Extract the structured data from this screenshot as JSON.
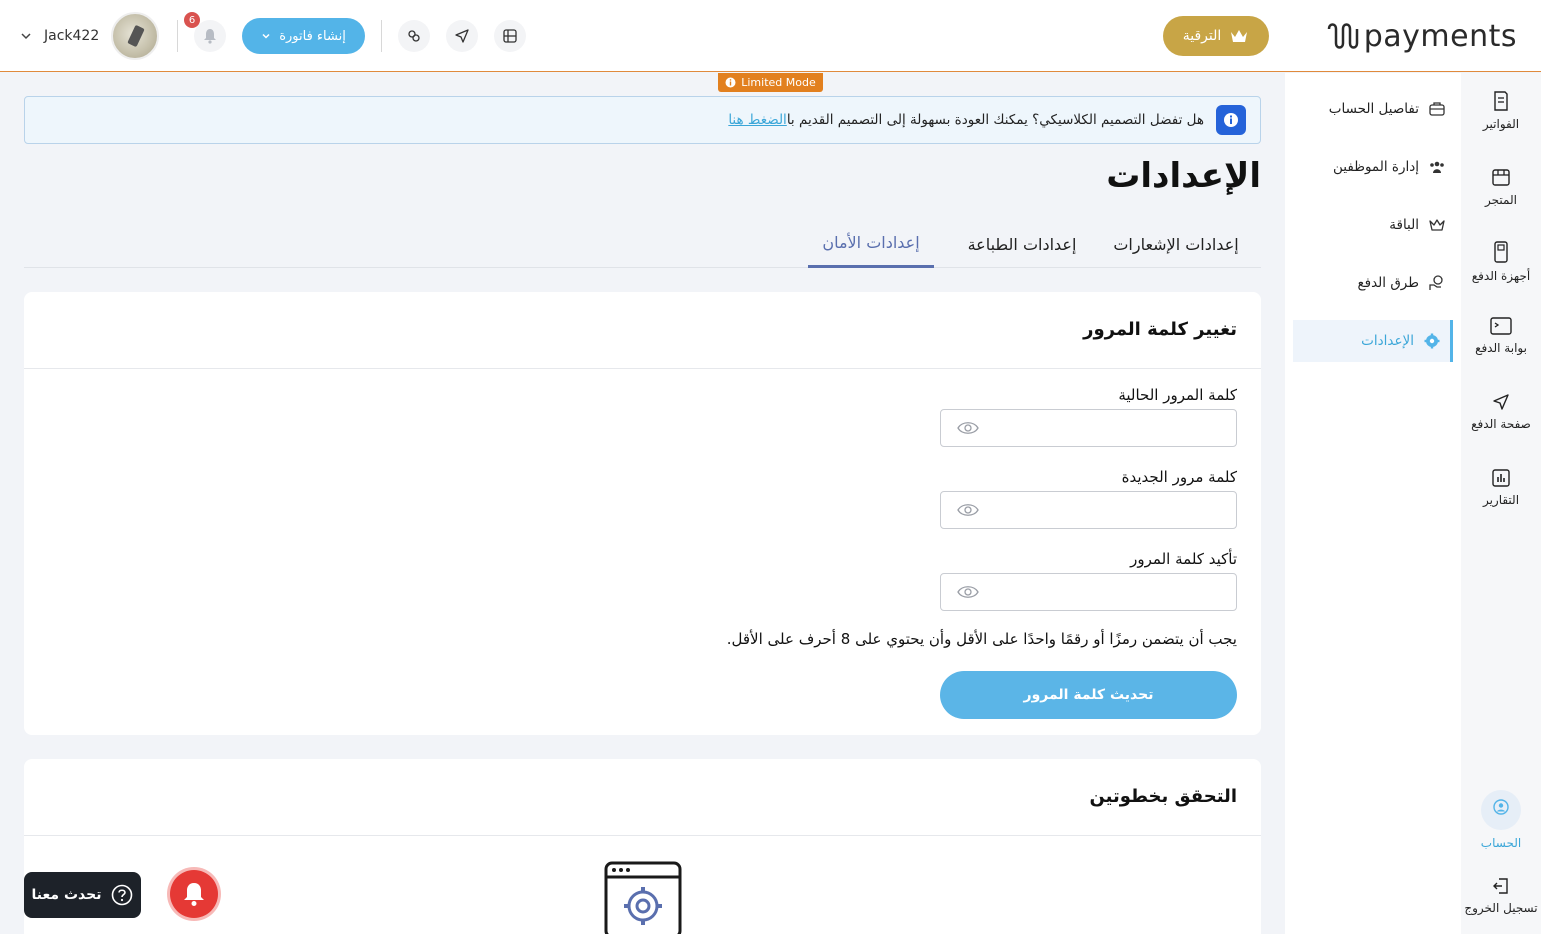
{
  "header": {
    "brand": "payments",
    "upgrade_label": "الترقية",
    "username": "Jack422",
    "notifications_count": "6",
    "create_invoice_label": "إنشاء فاتورة"
  },
  "rail": {
    "items": [
      {
        "label": "الفواتير",
        "icon": "invoice-icon"
      },
      {
        "label": "المتجر",
        "icon": "store-icon"
      },
      {
        "label": "أجهزة الدفع",
        "icon": "pos-device-icon"
      },
      {
        "label": "بوابة الدفع",
        "icon": "gateway-icon"
      },
      {
        "label": "صفحة الدفع",
        "icon": "send-icon"
      },
      {
        "label": "التقارير",
        "icon": "reports-icon"
      }
    ],
    "account_label": "الحساب",
    "logout_label": "تسجيل الخروج"
  },
  "submenu": {
    "items": [
      {
        "label": "تفاصيل الحساب",
        "icon": "briefcase-icon"
      },
      {
        "label": "إدارة الموظفين",
        "icon": "users-icon"
      },
      {
        "label": "الباقة",
        "icon": "crown-icon"
      },
      {
        "label": "طرق الدفع",
        "icon": "payment-methods-icon"
      },
      {
        "label": "الإعدادات",
        "icon": "gear-icon",
        "active": true
      }
    ]
  },
  "banner": {
    "limited_mode": "Limited Mode",
    "text": "هل تفضل التصميم الكلاسيكي؟ يمكنك العودة بسهولة إلى التصميم القديم با",
    "link": "الضغط هنا"
  },
  "page": {
    "title": "الإعدادات",
    "tabs": [
      "إعدادات الإشعارات",
      "إعدادات الطباعة",
      "إعدادات الأمان"
    ],
    "active_tab": "إعدادات الأمان"
  },
  "password_card": {
    "title": "تغيير كلمة المرور",
    "current_label": "كلمة المرور الحالية",
    "new_label": "كلمة مرور الجديدة",
    "confirm_label": "تأكيد كلمة المرور",
    "hint": "يجب أن يتضمن رمزًا أو رقمًا واحدًا على الأقل وأن يحتوي على 8 أحرف على الأقل.",
    "submit_label": "تحديث كلمة المرور"
  },
  "twofa_card": {
    "title": "التحقق بخطوتين"
  },
  "chat": {
    "label": "تحدث معنا"
  },
  "colors": {
    "accent": "#53b4e8",
    "gold": "#c8a546",
    "warning": "#e2801f",
    "tab_active": "#5a6fae"
  }
}
